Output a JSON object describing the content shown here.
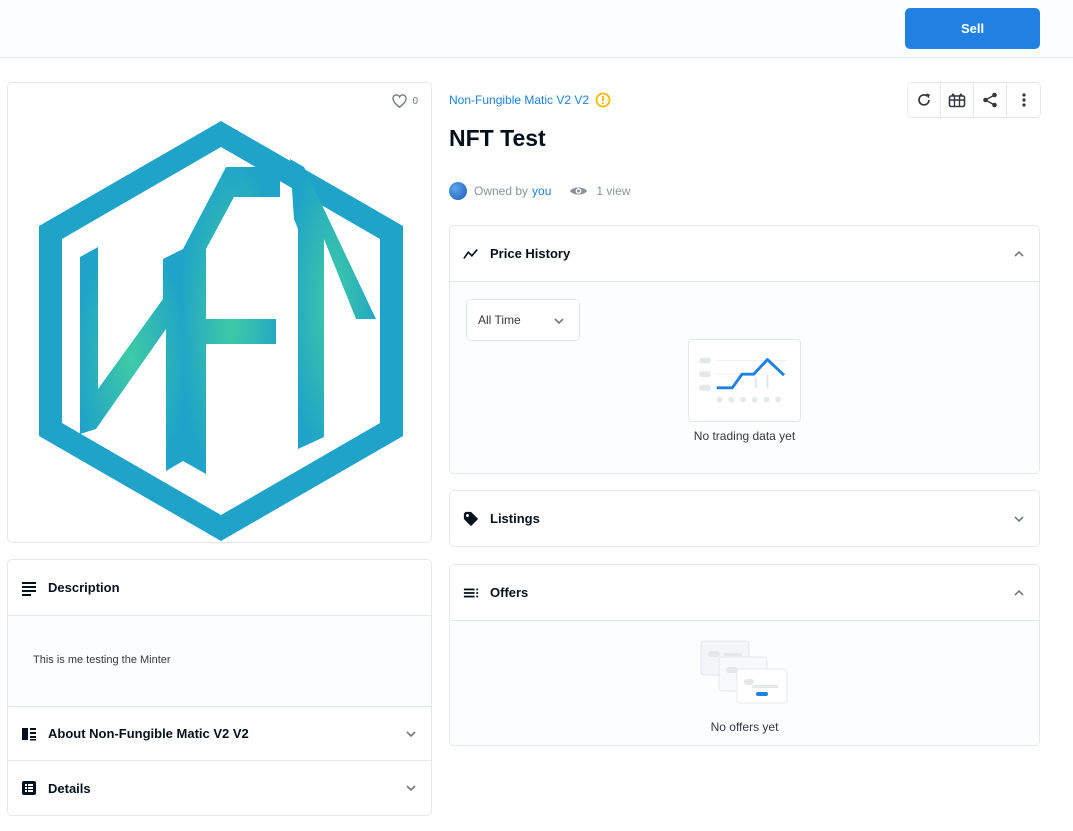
{
  "header": {
    "sell_label": "Sell"
  },
  "item": {
    "favorites_count": "0",
    "collection_name": "Non-Fungible Matic V2 V2",
    "title": "NFT Test",
    "owned_by_label": "Owned by",
    "owner": "you",
    "views": "1 view",
    "art_text": "NFT"
  },
  "actions": [
    "refresh-icon",
    "gift-icon",
    "share-icon",
    "more-icon"
  ],
  "description": {
    "heading": "Description",
    "text": "This is me testing the Minter"
  },
  "about": {
    "heading": "About Non-Fungible Matic V2 V2"
  },
  "details": {
    "heading": "Details"
  },
  "price_history": {
    "heading": "Price History",
    "range_selected": "All Time",
    "empty_text": "No trading data yet"
  },
  "listings": {
    "heading": "Listings"
  },
  "offers": {
    "heading": "Offers",
    "empty_text": "No offers yet"
  },
  "colors": {
    "accent": "#2081e2",
    "warning": "#f5b800",
    "art_blue": "#1fa3c8",
    "art_teal": "#3ecba5"
  }
}
